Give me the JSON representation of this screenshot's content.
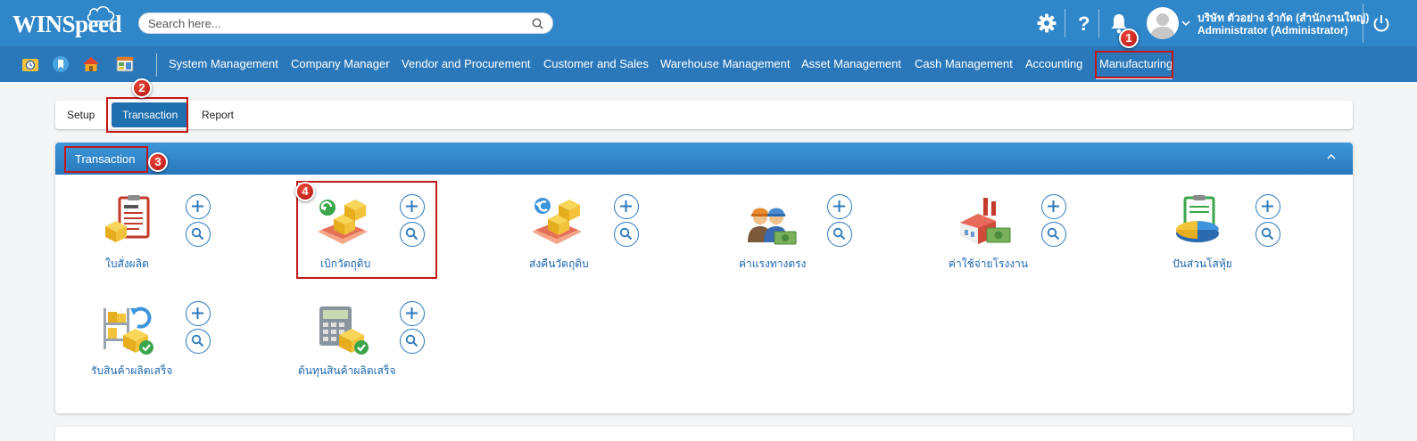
{
  "app": {
    "logo": "WINSpeed"
  },
  "search": {
    "placeholder": "Search here..."
  },
  "user": {
    "company": "บริษัท ตัวอย่าง จำกัด (สำนักงานใหญ่)",
    "name": "Administrator (Administrator)"
  },
  "nav": {
    "items": [
      "System Management",
      "Company Manager",
      "Vendor and Procurement",
      "Customer and Sales",
      "Warehouse Management",
      "Asset Management",
      "Cash Management",
      "Accounting",
      "Manufacturing"
    ],
    "active": "Manufacturing"
  },
  "tabs": {
    "setup": "Setup",
    "transaction": "Transaction",
    "report": "Report",
    "active": "Transaction"
  },
  "panel": {
    "title": "Transaction",
    "tiles": [
      {
        "label": "ใบสั่งผลิต",
        "icon": "production-order-icon"
      },
      {
        "label": "เบิกวัตถุดิบ",
        "icon": "material-requisition-icon"
      },
      {
        "label": "ส่งคืนวัตถุดิบ",
        "icon": "material-return-icon"
      },
      {
        "label": "ค่าแรงทางตรง",
        "icon": "direct-labor-icon"
      },
      {
        "label": "ค่าใช้จ่ายโรงงาน",
        "icon": "factory-overhead-icon"
      },
      {
        "label": "ปันส่วนโสหุ้ย",
        "icon": "overhead-allocation-icon"
      },
      {
        "label": "รับสินค้าผลิตเสร็จ",
        "icon": "receive-finished-goods-icon"
      },
      {
        "label": "ต้นทุนสินค้าผลิตเสร็จ",
        "icon": "finished-goods-cost-icon"
      }
    ]
  },
  "annotations": [
    "1",
    "2",
    "3",
    "4"
  ],
  "colors": {
    "header": "#2f86c9",
    "nav": "#2a78b9",
    "accent": "#1d6fae",
    "annotation": "#c41818"
  }
}
